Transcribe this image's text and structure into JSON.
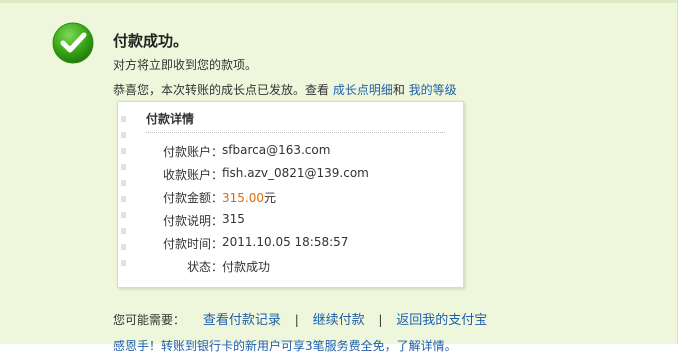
{
  "status": {
    "title": "付款成功。",
    "subtitle": "对方将立即收到您的款项。",
    "growth_text": "恭喜您，本次转账的成长点已发放。查看 ",
    "growth_link": "成长点明细",
    "growth_and": "和 ",
    "level_link": "我的等级"
  },
  "details": {
    "title": "付款详情",
    "rows": [
      {
        "label": "付款账户：",
        "value": "sfbarca@163.com"
      },
      {
        "label": "收款账户：",
        "value": "fish.azv_0821@139.com"
      },
      {
        "label": "付款金额：",
        "value": "315.00",
        "suffix": "元"
      },
      {
        "label": "付款说明：",
        "value": "315"
      },
      {
        "label": "付款时间：",
        "value": "2011.10.05 18:58:57"
      },
      {
        "label": "状态：",
        "value": "付款成功"
      }
    ]
  },
  "more": {
    "label": "您可能需要：",
    "link1": "查看付款记录",
    "link2": "继续付款",
    "link3": "返回我的支付宝",
    "divider": "|"
  },
  "bottom": {
    "text": "感恩手！转账到银行卡的新用户可享3笔服务费全免，了解详情。"
  },
  "colors": {
    "background": "#eef7dc",
    "link": "#1f5fa8",
    "amount": "#e06a06",
    "success_icon": "#3aa817"
  }
}
